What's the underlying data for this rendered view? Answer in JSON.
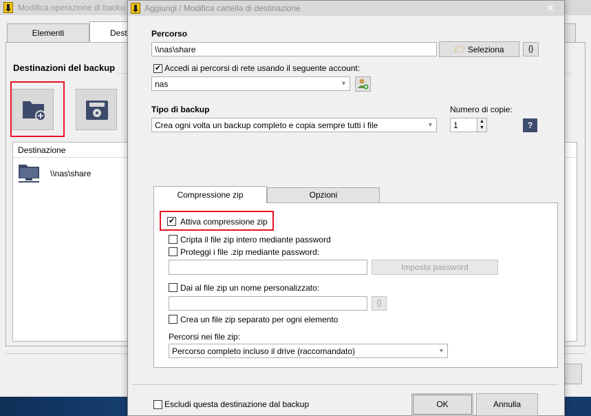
{
  "back_window": {
    "title": "Modifica operazione di backu",
    "tabs": [
      "Elementi",
      "Desti"
    ],
    "section_heading": "Destinazioni del backup",
    "list_header": "Destinazione",
    "list_rows": [
      {
        "path": "\\\\nas\\share"
      }
    ]
  },
  "dialog": {
    "title": "Aggiungi / Modifica cartella di destinazione",
    "close_glyph": "✕",
    "percorso": {
      "label": "Percorso",
      "value": "\\\\nas\\share",
      "browse_button": "Seleziona",
      "macro_button": "{}"
    },
    "network": {
      "checkbox_label": "Accedi ai percorsi di rete usando il seguente account:",
      "checked": true,
      "account_value": "nas"
    },
    "backup_type": {
      "label": "Tipo di backup",
      "value": "Crea ogni volta un backup completo e copia sempre tutti i file"
    },
    "copies": {
      "label": "Numero di copie:",
      "value": "1",
      "help_button": "?"
    },
    "tabs": [
      "Compressione zip",
      "Opzioni"
    ],
    "zip": {
      "enable": {
        "label": "Attiva compressione zip",
        "checked": true
      },
      "encrypt_whole": {
        "label": "Cripta il file zip intero mediante password",
        "checked": false
      },
      "protect_files": {
        "label": "Proteggi i file .zip mediante password:",
        "checked": false
      },
      "password_value": "",
      "set_password_button": "Imposta password",
      "custom_name": {
        "label": "Dai al file zip un nome personalizzato:",
        "checked": false
      },
      "custom_name_value": "",
      "custom_name_macro": "{}",
      "separate_zip": {
        "label": "Crea un file zip separato per ogni elemento",
        "checked": false
      },
      "paths_label": "Percorsi nei file zip:",
      "paths_value": "Percorso completo incluso il drive (raccomandato)"
    },
    "exclude": {
      "label": "Escludi questa destinazione dal backup",
      "checked": false
    },
    "ok_button": "OK",
    "cancel_button": "Annulla"
  },
  "colors": {
    "highlight": "#e81123",
    "folder_icon": "#3d4a6b"
  }
}
